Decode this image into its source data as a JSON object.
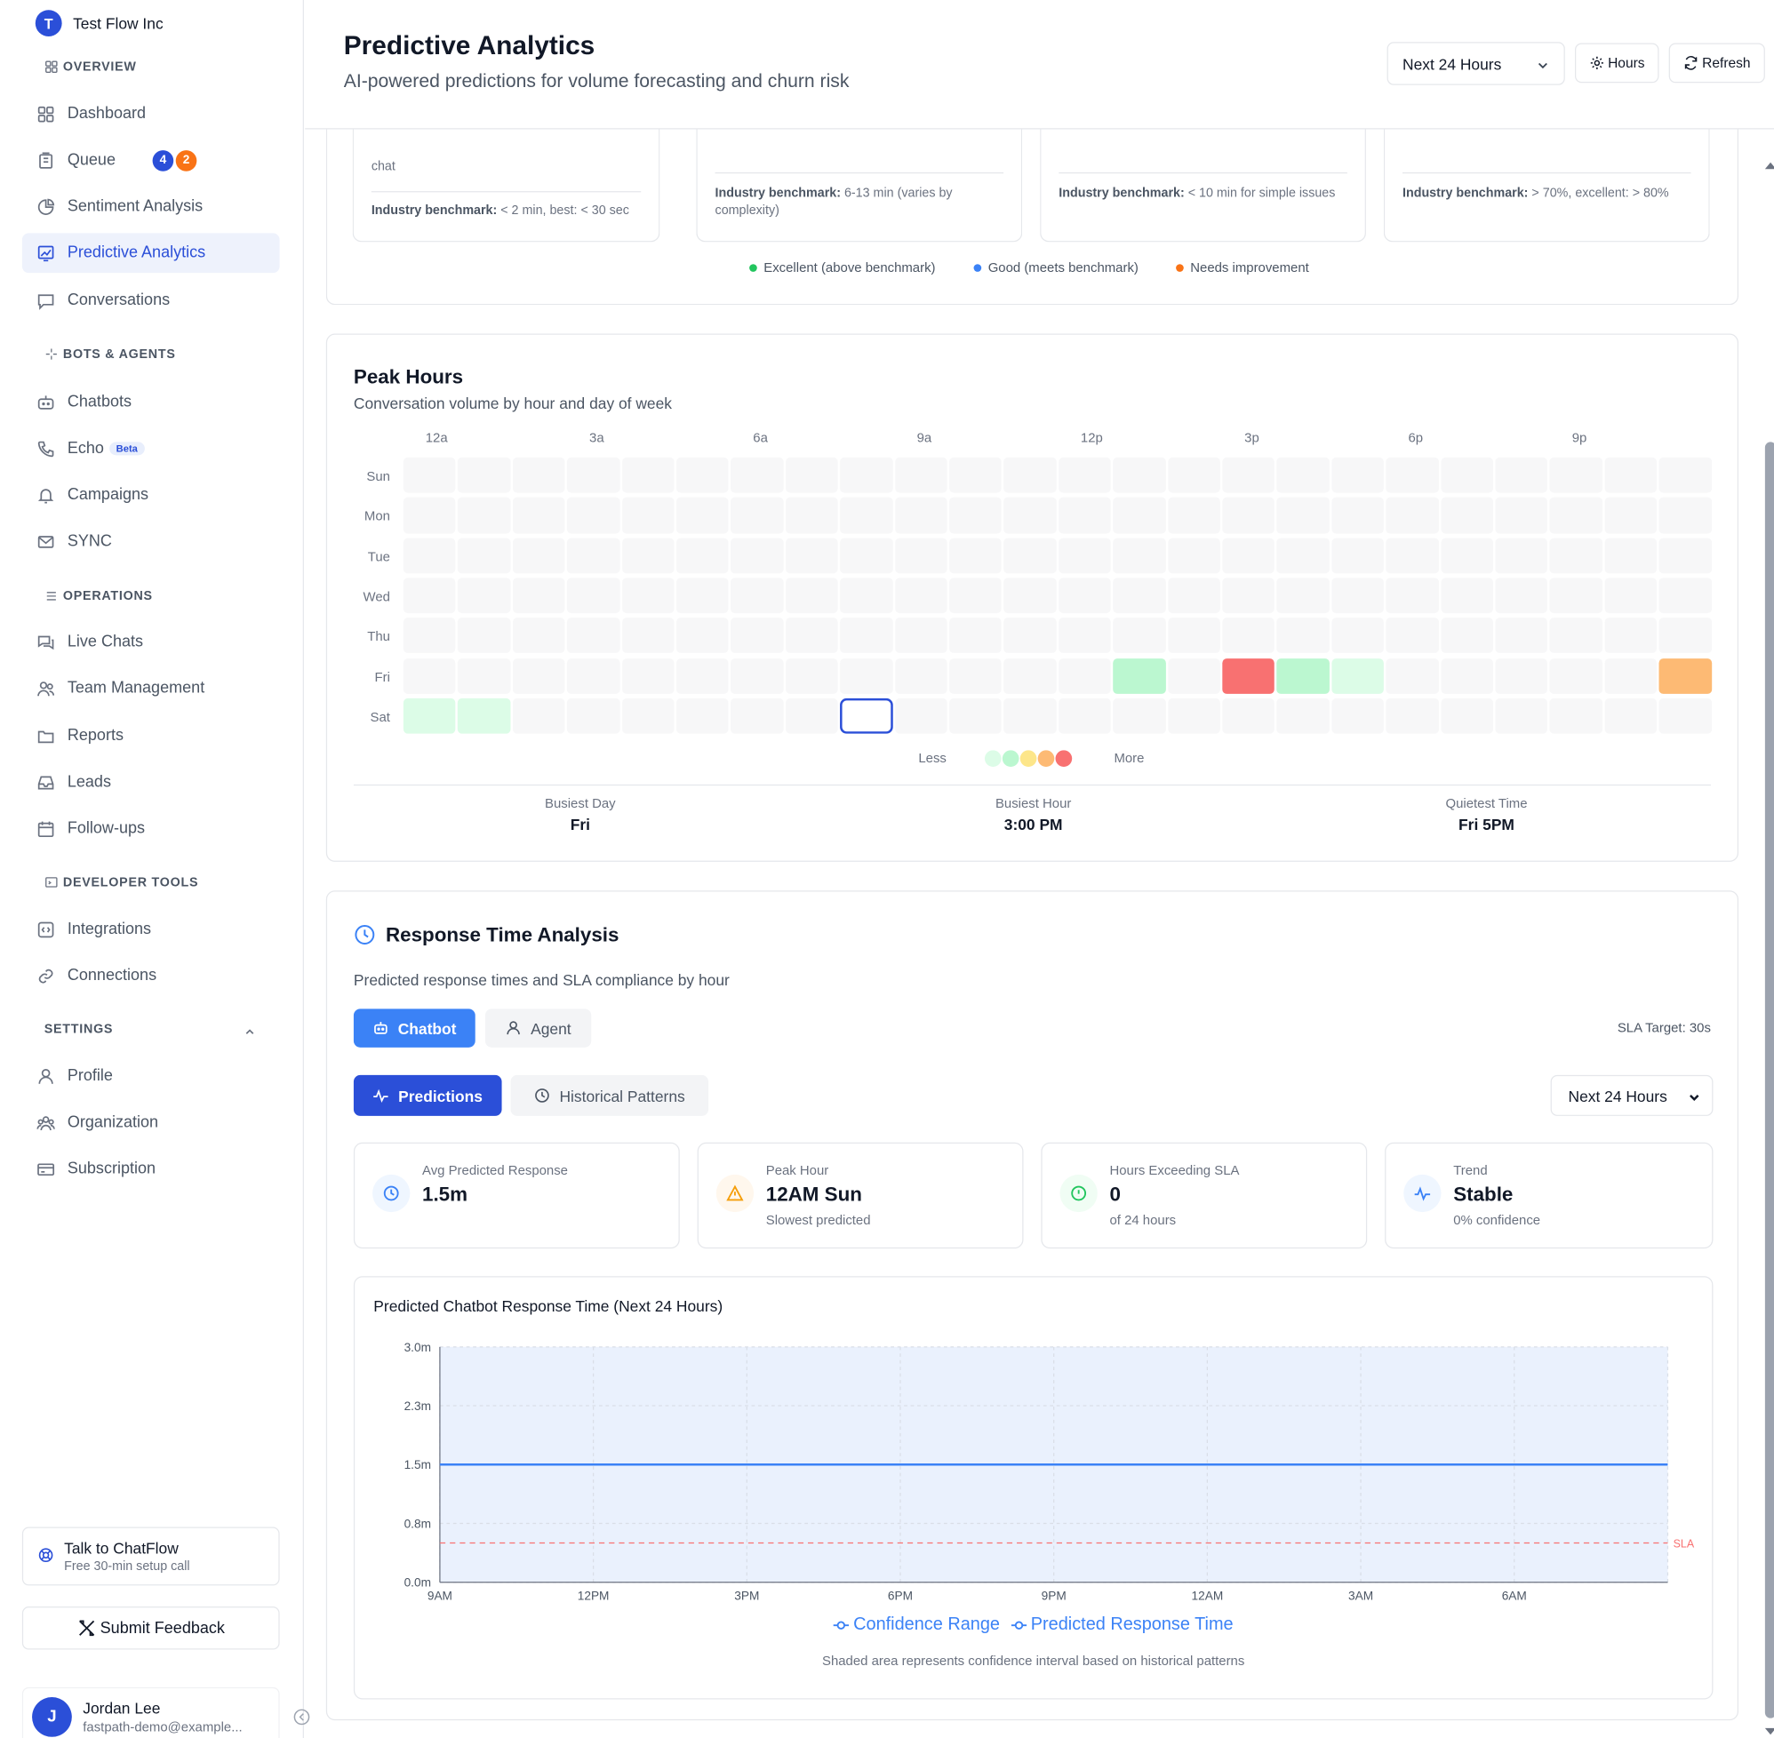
{
  "org": {
    "initial": "T",
    "name": "Test Flow Inc"
  },
  "sidebar": {
    "sections": {
      "overview": "OVERVIEW",
      "bots": "BOTS & AGENTS",
      "operations": "OPERATIONS",
      "developer": "DEVELOPER TOOLS",
      "settings": "SETTINGS"
    },
    "items": {
      "dashboard": "Dashboard",
      "queue": "Queue",
      "queue_badge_blue": "4",
      "queue_badge_orange": "2",
      "sentiment": "Sentiment Analysis",
      "predictive": "Predictive Analytics",
      "conversations": "Conversations",
      "chatbots": "Chatbots",
      "echo": "Echo",
      "echo_badge": "Beta",
      "campaigns": "Campaigns",
      "sync": "SYNC",
      "live_chats": "Live Chats",
      "team": "Team Management",
      "reports": "Reports",
      "leads": "Leads",
      "followups": "Follow-ups",
      "integrations": "Integrations",
      "connections": "Connections",
      "profile": "Profile",
      "organization": "Organization",
      "subscription": "Subscription"
    },
    "cta_title": "Talk to ChatFlow",
    "cta_sub": "Free 30-min setup call",
    "feedback": "Submit Feedback",
    "user": {
      "initial": "J",
      "name": "Jordan Lee",
      "email": "fastpath-demo@example..."
    }
  },
  "header": {
    "title": "Predictive Analytics",
    "subtitle": "AI-powered predictions for volume forecasting and churn risk",
    "range": "Next 24 Hours",
    "hours_btn": "Hours",
    "refresh_btn": "Refresh"
  },
  "benchmarks": {
    "card1_top": "chat",
    "card1": {
      "label": "Industry benchmark:",
      "text": " < 2 min, best: < 30 sec"
    },
    "card2": {
      "label": "Industry benchmark:",
      "text": " 6-13 min (varies by complexity)"
    },
    "card3": {
      "label": "Industry benchmark:",
      "text": " < 10 min for simple issues"
    },
    "card4": {
      "label": "Industry benchmark:",
      "text": " > 70%, excellent: > 80%"
    },
    "legend": {
      "excellent": "Excellent (above benchmark)",
      "good": "Good (meets benchmark)",
      "needs": "Needs improvement"
    }
  },
  "peak": {
    "title": "Peak Hours",
    "subtitle": "Conversation volume by hour and day of week",
    "hour_labels": [
      "12a",
      "3a",
      "6a",
      "9a",
      "12p",
      "3p",
      "6p",
      "9p"
    ],
    "days": [
      "Sun",
      "Mon",
      "Tue",
      "Wed",
      "Thu",
      "Fri",
      "Sat"
    ],
    "highlights": [
      {
        "day": 5,
        "hour": 13,
        "level": 1
      },
      {
        "day": 5,
        "hour": 15,
        "level": 4
      },
      {
        "day": 5,
        "hour": 16,
        "level": 1
      },
      {
        "day": 5,
        "hour": 17,
        "level": 0
      },
      {
        "day": 5,
        "hour": 23,
        "level": 3
      },
      {
        "day": 6,
        "hour": 0,
        "level": 0
      },
      {
        "day": 6,
        "hour": 1,
        "level": 0
      }
    ],
    "selected": {
      "day": 6,
      "hour": 8
    },
    "legend_less": "Less",
    "legend_more": "More",
    "scale_colors": [
      "#dcfce7",
      "#bbf7d0",
      "#fde68a",
      "#fdba74",
      "#f87171"
    ],
    "summary": {
      "busiest_day_label": "Busiest Day",
      "busiest_day": "Fri",
      "busiest_hour_label": "Busiest Hour",
      "busiest_hour": "3:00 PM",
      "quietest_label": "Quietest Time",
      "quietest": "Fri 5PM"
    }
  },
  "rta": {
    "title": "Response Time Analysis",
    "subtitle": "Predicted response times and SLA compliance by hour",
    "tab_chatbot": "Chatbot",
    "tab_agent": "Agent",
    "sla_target": "SLA Target: 30s",
    "view_predictions": "Predictions",
    "view_history": "Historical Patterns",
    "range": "Next 24 Hours",
    "stats": {
      "avg": {
        "label": "Avg Predicted Response",
        "value": "1.5m"
      },
      "peak": {
        "label": "Peak Hour",
        "value": "12AM Sun",
        "sub": "Slowest predicted"
      },
      "exceed": {
        "label": "Hours Exceeding SLA",
        "value": "0",
        "sub": "of 24 hours"
      },
      "trend": {
        "label": "Trend",
        "value": "Stable",
        "sub": "0% confidence"
      }
    }
  },
  "chart_data": {
    "type": "area",
    "title": "Predicted Chatbot Response Time (Next 24 Hours)",
    "x_ticks": [
      "9AM",
      "12PM",
      "3PM",
      "6PM",
      "9PM",
      "12AM",
      "3AM",
      "6AM"
    ],
    "y_ticks": [
      "0.0m",
      "0.8m",
      "1.5m",
      "2.3m",
      "3.0m"
    ],
    "ylim": [
      0,
      3.0
    ],
    "y_unit": "minutes",
    "hours": 24,
    "series": [
      {
        "name": "Predicted Response Time",
        "values": [
          1.5,
          1.5,
          1.5,
          1.5,
          1.5,
          1.5,
          1.5,
          1.5,
          1.5,
          1.5,
          1.5,
          1.5,
          1.5,
          1.5,
          1.5,
          1.5,
          1.5,
          1.5,
          1.5,
          1.5,
          1.5,
          1.5,
          1.5,
          1.5
        ]
      },
      {
        "name": "Confidence Range",
        "lower": 0,
        "upper": 3.0
      }
    ],
    "sla_line": {
      "value": 0.5,
      "label": "SLA"
    },
    "legend": [
      "Confidence Range",
      "Predicted Response Time"
    ],
    "note": "Shaded area represents confidence interval based on historical patterns",
    "colors": {
      "line": "#3b82f6",
      "band": "#eaf1fd",
      "sla": "#f87171"
    }
  }
}
